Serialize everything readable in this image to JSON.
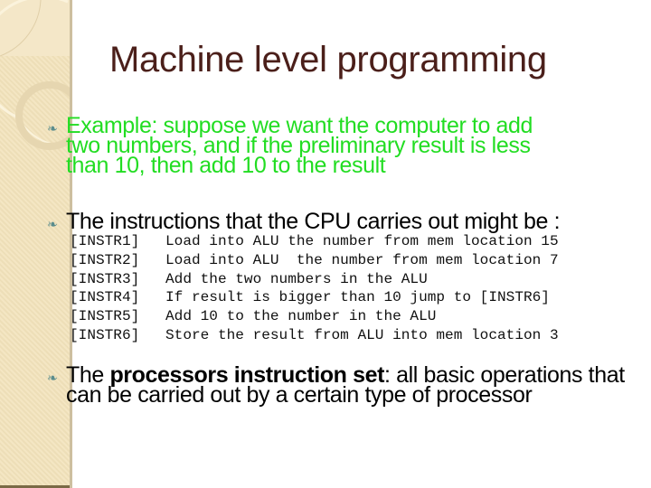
{
  "slide": {
    "title": "Machine level programming",
    "bullet_icon": "scroll-bullet-icon",
    "colors": {
      "title": "#4b1f1a",
      "example_text": "#22dd22",
      "body_text": "#000000",
      "sidebar": "#f2e2bb"
    },
    "bullets": [
      {
        "lines": [
          "Example: suppose we want the computer to add",
          "two numbers, and if the preliminary result is less",
          "than 10, then add 10 to the result"
        ]
      },
      {
        "text": "The instructions that the CPU  carries out might be :"
      },
      {
        "prefix": "The ",
        "bold": "processors instruction set",
        "rest_line1": ": all basic operations that",
        "line2": "can be carried out by a certain type of processor"
      }
    ],
    "instructions": [
      {
        "label": "[INSTR1]",
        "text": "Load into ALU the number from mem location 15"
      },
      {
        "label": "[INSTR2]",
        "text": "Load into ALU  the number from mem location 7"
      },
      {
        "label": "[INSTR3]",
        "text": "Add the two numbers in the ALU"
      },
      {
        "label": "[INSTR4]",
        "text": "If result is bigger than 10 jump to [INSTR6]"
      },
      {
        "label": "[INSTR5]",
        "text": "Add 10 to the number in the ALU"
      },
      {
        "label": "[INSTR6]",
        "text": "Store the result from ALU into mem location 3"
      }
    ]
  }
}
